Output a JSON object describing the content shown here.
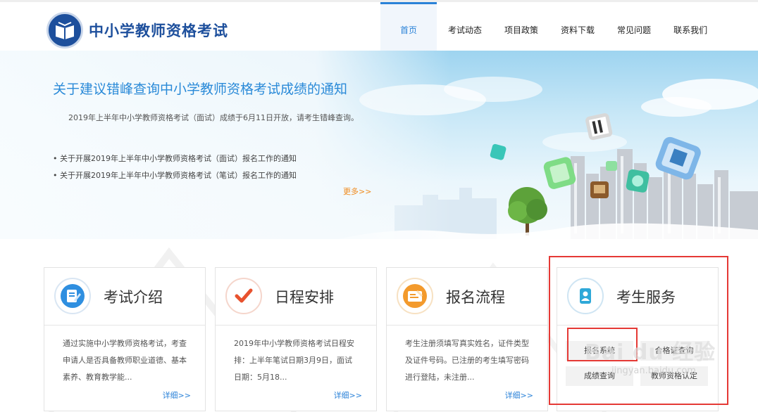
{
  "header": {
    "site_title": "中小学教师资格考试",
    "nav": [
      {
        "label": "首页",
        "active": true
      },
      {
        "label": "考试动态",
        "active": false
      },
      {
        "label": "项目政策",
        "active": false
      },
      {
        "label": "资料下载",
        "active": false
      },
      {
        "label": "常见问题",
        "active": false
      },
      {
        "label": "联系我们",
        "active": false
      }
    ]
  },
  "banner": {
    "title": "关于建议错峰查询中小学教师资格考试成绩的通知",
    "text": "2019年上半年中小学教师资格考试（面试）成绩于6月11日开放，请考生错峰查询。",
    "links": [
      "• 关于开展2019年上半年中小学教师资格考试（面试）报名工作的通知",
      "• 关于开展2019年上半年中小学教师资格考试（笔试）报名工作的通知"
    ],
    "more": "更多>>"
  },
  "cards": [
    {
      "title": "考试介绍",
      "icon": "exam-intro-icon",
      "text": "通过实施中小学教师资格考试，考查申请人是否具备教师职业道德、基本素养、教育教学能...",
      "more": "详细>>"
    },
    {
      "title": "日程安排",
      "icon": "schedule-check-icon",
      "text": "2019年中小学教师资格考试日程安排：上半年笔试日期3月9日，面试日期：5月18...",
      "more": "详细>>"
    },
    {
      "title": "报名流程",
      "icon": "registration-icon",
      "text": "考生注册须填写真实姓名，证件类型及证件号码。已注册的考生填写密码进行登陆，未注册...",
      "more": "详细>>"
    },
    {
      "title": "考生服务",
      "icon": "candidate-service-icon"
    }
  ],
  "services": {
    "register": "报名系统",
    "cert_query": "合格证查询",
    "score_query": "成绩查询",
    "qualification": "教师资格认定"
  },
  "watermark": {
    "main": "Bai du 经验",
    "sub": "jingyan.baidu.com"
  },
  "colors": {
    "brand": "#1d4f9c",
    "accent": "#2a82d8",
    "more": "#f08a1c",
    "highlight": "#e53935"
  }
}
